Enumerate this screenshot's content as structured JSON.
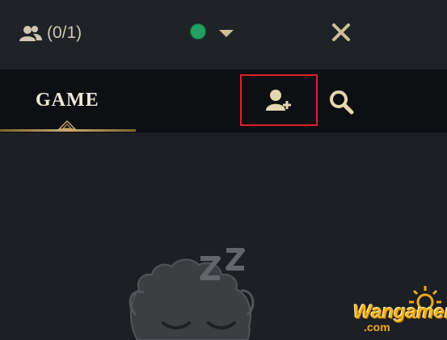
{
  "header": {
    "friend_count": "(0/1)",
    "status_color": "#22a05f"
  },
  "tabs": [
    {
      "label": "GAME",
      "active": true
    }
  ],
  "icons": {
    "friends": "people-icon",
    "status_caret": "chevron-down-icon",
    "close": "close-icon",
    "add_friend": "add-friend-icon",
    "search": "search-icon",
    "tab_marker": "tab-indicator-icon",
    "sleep": "sleeping-poro-icon"
  },
  "colors": {
    "accent_gold": "#c8aa6e",
    "highlight_box": "#d9222a"
  },
  "watermark": {
    "text": "Wangamer",
    "sub": ".com"
  }
}
